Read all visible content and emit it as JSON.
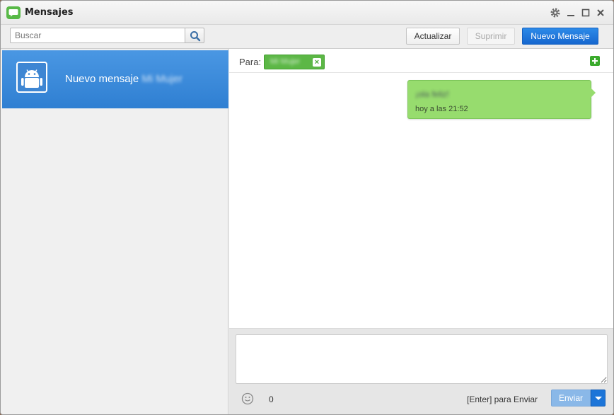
{
  "app": {
    "title": "Mensajes",
    "icons": {
      "app": "chat-bubble-icon",
      "settings": "gear-icon",
      "minimize": "minimize-icon",
      "maximize": "maximize-icon",
      "close": "close-icon"
    }
  },
  "toolbar": {
    "search_placeholder": "Buscar",
    "refresh_label": "Actualizar",
    "delete_label": "Suprimir",
    "new_message_label": "Nuevo Mensaje"
  },
  "sidebar": {
    "items": [
      {
        "label": "Nuevo mensaje",
        "contact": "Mi Mujer",
        "icon": "android-icon",
        "selected": true
      }
    ]
  },
  "conversation": {
    "to_label": "Para:",
    "recipient": "Mi Mujer",
    "messages": [
      {
        "text": "¡ola feliz!",
        "time": "hoy a las 21:52",
        "outgoing": true
      }
    ]
  },
  "compose": {
    "char_count": "0",
    "enter_hint": "[Enter] para Enviar",
    "send_label": "Enviar"
  },
  "colors": {
    "accent": "#1a6fd4",
    "selected_item": "#3a87d8",
    "bubble": "#97dc6e",
    "chip": "#5cb746"
  }
}
